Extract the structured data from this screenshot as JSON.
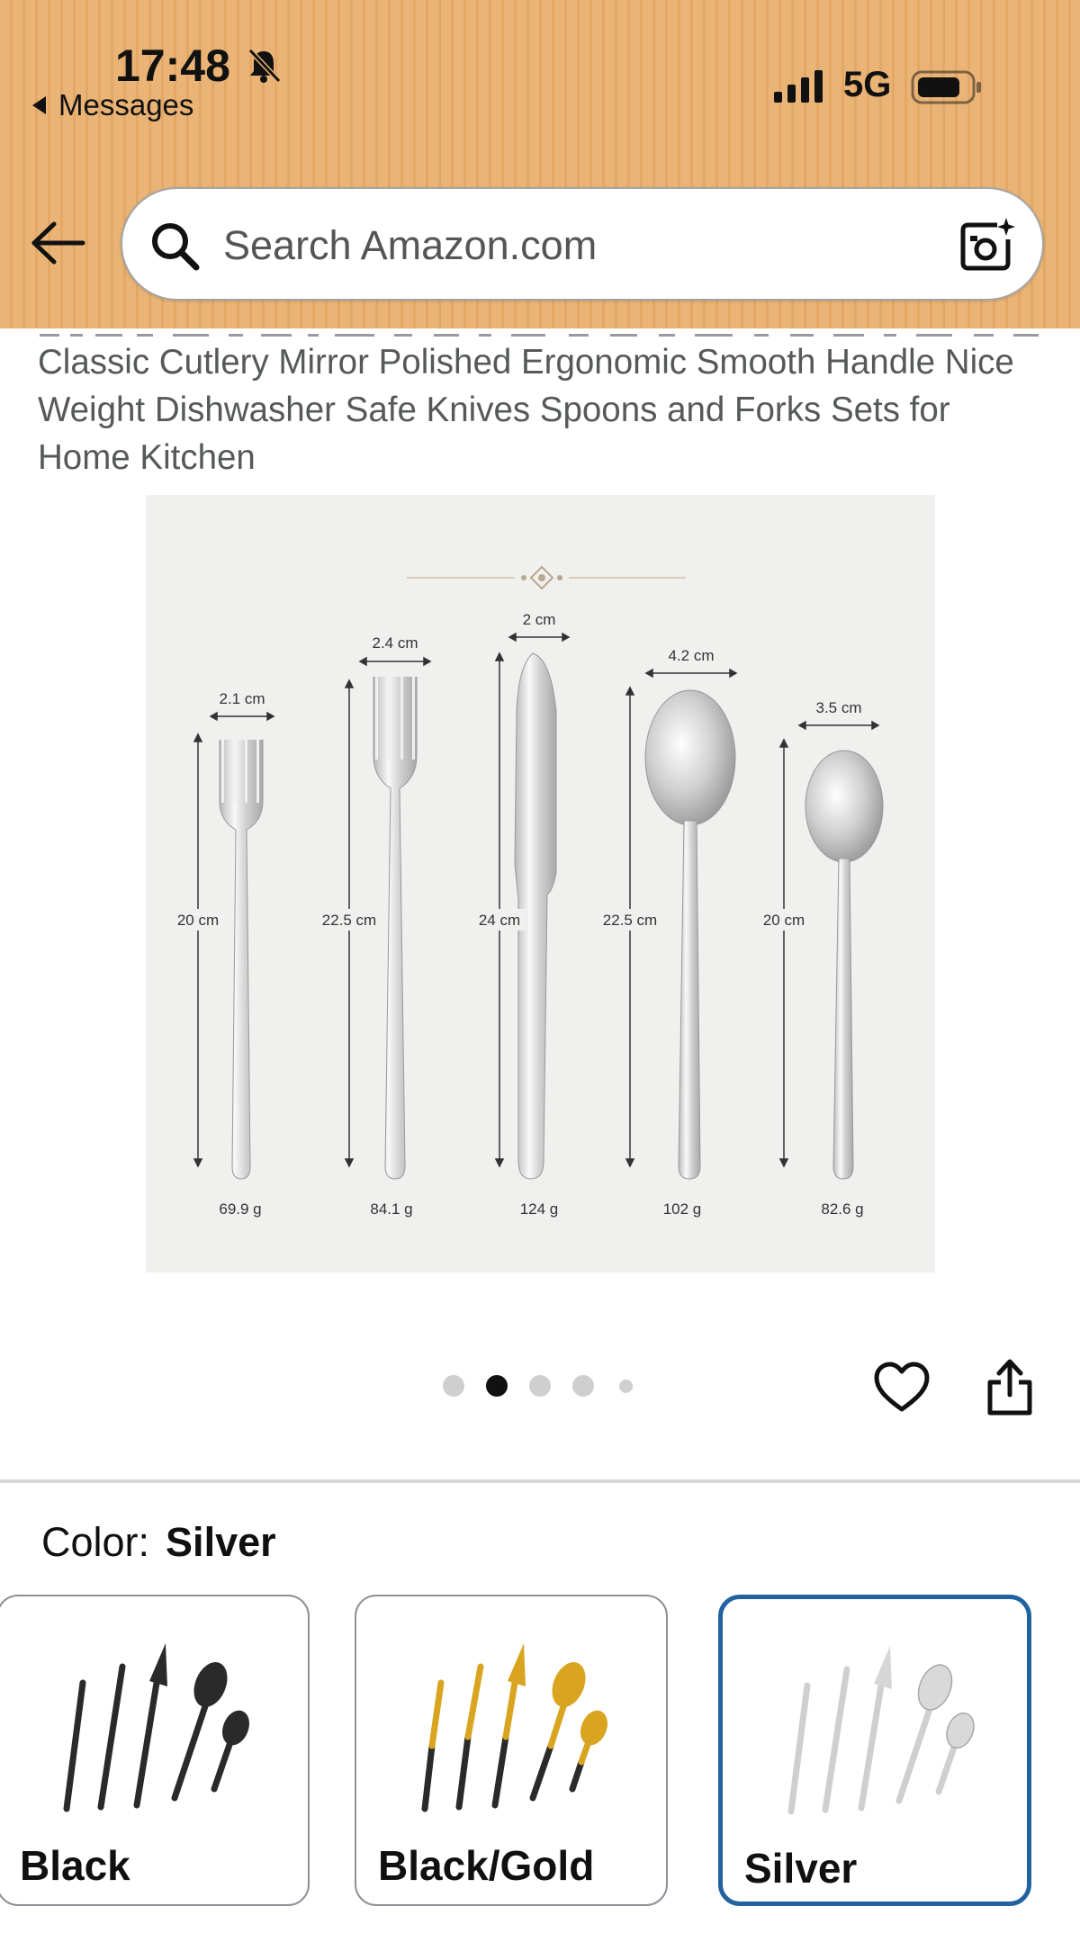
{
  "status_bar": {
    "time": "17:48",
    "back_to_app": "Messages",
    "network": "5G",
    "icons": [
      "bell-slash-icon",
      "signal-icon",
      "battery-icon"
    ]
  },
  "nav": {
    "back_icon": "arrow-left-icon",
    "search_placeholder": "Search Amazon.com",
    "search_icon": "magnifier-icon",
    "camera_icon": "camera-sparkle-icon"
  },
  "product": {
    "title": "Classic Cutlery Mirror Polished Ergonomic Smooth Handle Nice Weight Dishwasher Safe Knives Spoons and Forks Sets for Home Kitchen",
    "image": {
      "items": [
        {
          "name": "salad-fork",
          "width": "2.1 cm",
          "length": "20 cm",
          "weight": "69.9 g"
        },
        {
          "name": "dinner-fork",
          "width": "2.4 cm",
          "length": "22.5 cm",
          "weight": "84.1 g"
        },
        {
          "name": "knife",
          "width": "2 cm",
          "length": "24 cm",
          "weight": "124 g"
        },
        {
          "name": "dinner-spoon",
          "width": "4.2 cm",
          "length": "22.5 cm",
          "weight": "102 g"
        },
        {
          "name": "tea-spoon",
          "width": "3.5 cm",
          "length": "20 cm",
          "weight": "82.6 g"
        }
      ]
    },
    "carousel": {
      "count": 5,
      "active_index": 1
    },
    "actions": {
      "favorite_icon": "heart-icon",
      "share_icon": "share-icon"
    }
  },
  "color_selector": {
    "label": "Color:",
    "selected": "Silver",
    "options": [
      {
        "label": "Black",
        "color": "#2a2a2a",
        "accent": "#2a2a2a"
      },
      {
        "label": "Black/Gold",
        "color": "#2a2a2a",
        "accent": "#d9a520"
      },
      {
        "label": "Silver",
        "color": "#d9d9d9",
        "accent": "#d9d9d9"
      }
    ]
  }
}
